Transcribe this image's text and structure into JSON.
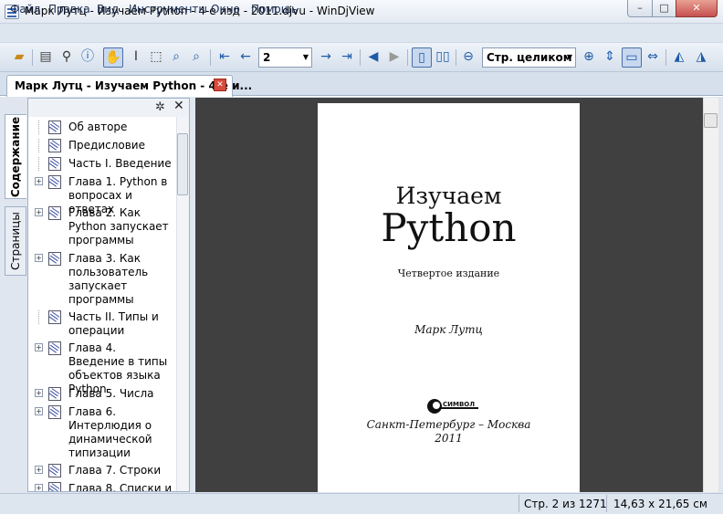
{
  "window": {
    "title": "Марк Лутц - Изучаем Python - 4-е изд - 2011.djvu - WinDjView",
    "minimize": "–",
    "maximize": "□",
    "close": "✕"
  },
  "menu": [
    "Файл",
    "Правка",
    "Вид",
    "Инструменты",
    "Окно",
    "Помощь"
  ],
  "toolbar": {
    "page_number": "2",
    "zoom": "Стр. целиком",
    "icons": [
      "open-icon",
      "print-icon",
      "find-icon",
      "info-icon",
      "hand-icon",
      "text-select-icon",
      "rect-select-icon",
      "zoom-in-tool-icon",
      "magnify-icon",
      "first-page-icon",
      "prev-page-icon",
      "next-page-icon",
      "last-page-icon",
      "back-icon",
      "forward-icon",
      "single-page-icon",
      "two-page-icon",
      "zoom-out-icon",
      "zoom-in-icon",
      "fit-page-icon",
      "fit-width-icon",
      "rotate-icon",
      "rotate-left-icon",
      "rotate-right-icon"
    ]
  },
  "tab": {
    "label": "Марк Лутц - Изучаем Python - 4-е и...",
    "close": "✕"
  },
  "sidebar": {
    "tabs": [
      "Содержание",
      "Страницы"
    ],
    "gear": "✲",
    "close": "✕",
    "items": [
      {
        "label": "Об авторе",
        "expandable": false
      },
      {
        "label": "Предисловие",
        "expandable": false
      },
      {
        "label": "Часть I. Введение",
        "expandable": false
      },
      {
        "label": "Глава 1. Python в вопросах и ответах",
        "expandable": true
      },
      {
        "label": "Глава 2. Как Python запускает программы",
        "expandable": true
      },
      {
        "label": "Глава 3. Как пользователь запускает программы",
        "expandable": true
      },
      {
        "label": "Часть II. Типы и операции",
        "expandable": false
      },
      {
        "label": "Глава 4. Введение в типы объектов языка Python",
        "expandable": true
      },
      {
        "label": "Глава 5. Числа",
        "expandable": true
      },
      {
        "label": "Глава 6. Интерлюдия о динамической типизации",
        "expandable": true
      },
      {
        "label": "Глава 7. Строки",
        "expandable": true
      },
      {
        "label": "Глава 8. Списки и",
        "expandable": true
      }
    ]
  },
  "book_page": {
    "title_line1": "Изучаем",
    "title_line2": "Python",
    "edition": "Четвертое издание",
    "author": "Марк Лутц",
    "publisher": "СИМВОЛ",
    "city": "Санкт-Петербург – Москва",
    "year": "2011"
  },
  "status": {
    "page": "Стр. 2 из 1271",
    "size": "14,63 x 21,65 см"
  },
  "colors": {
    "viewer_background": "#404040",
    "chrome": "#dde5ef",
    "accent": "#1e5aa8"
  }
}
